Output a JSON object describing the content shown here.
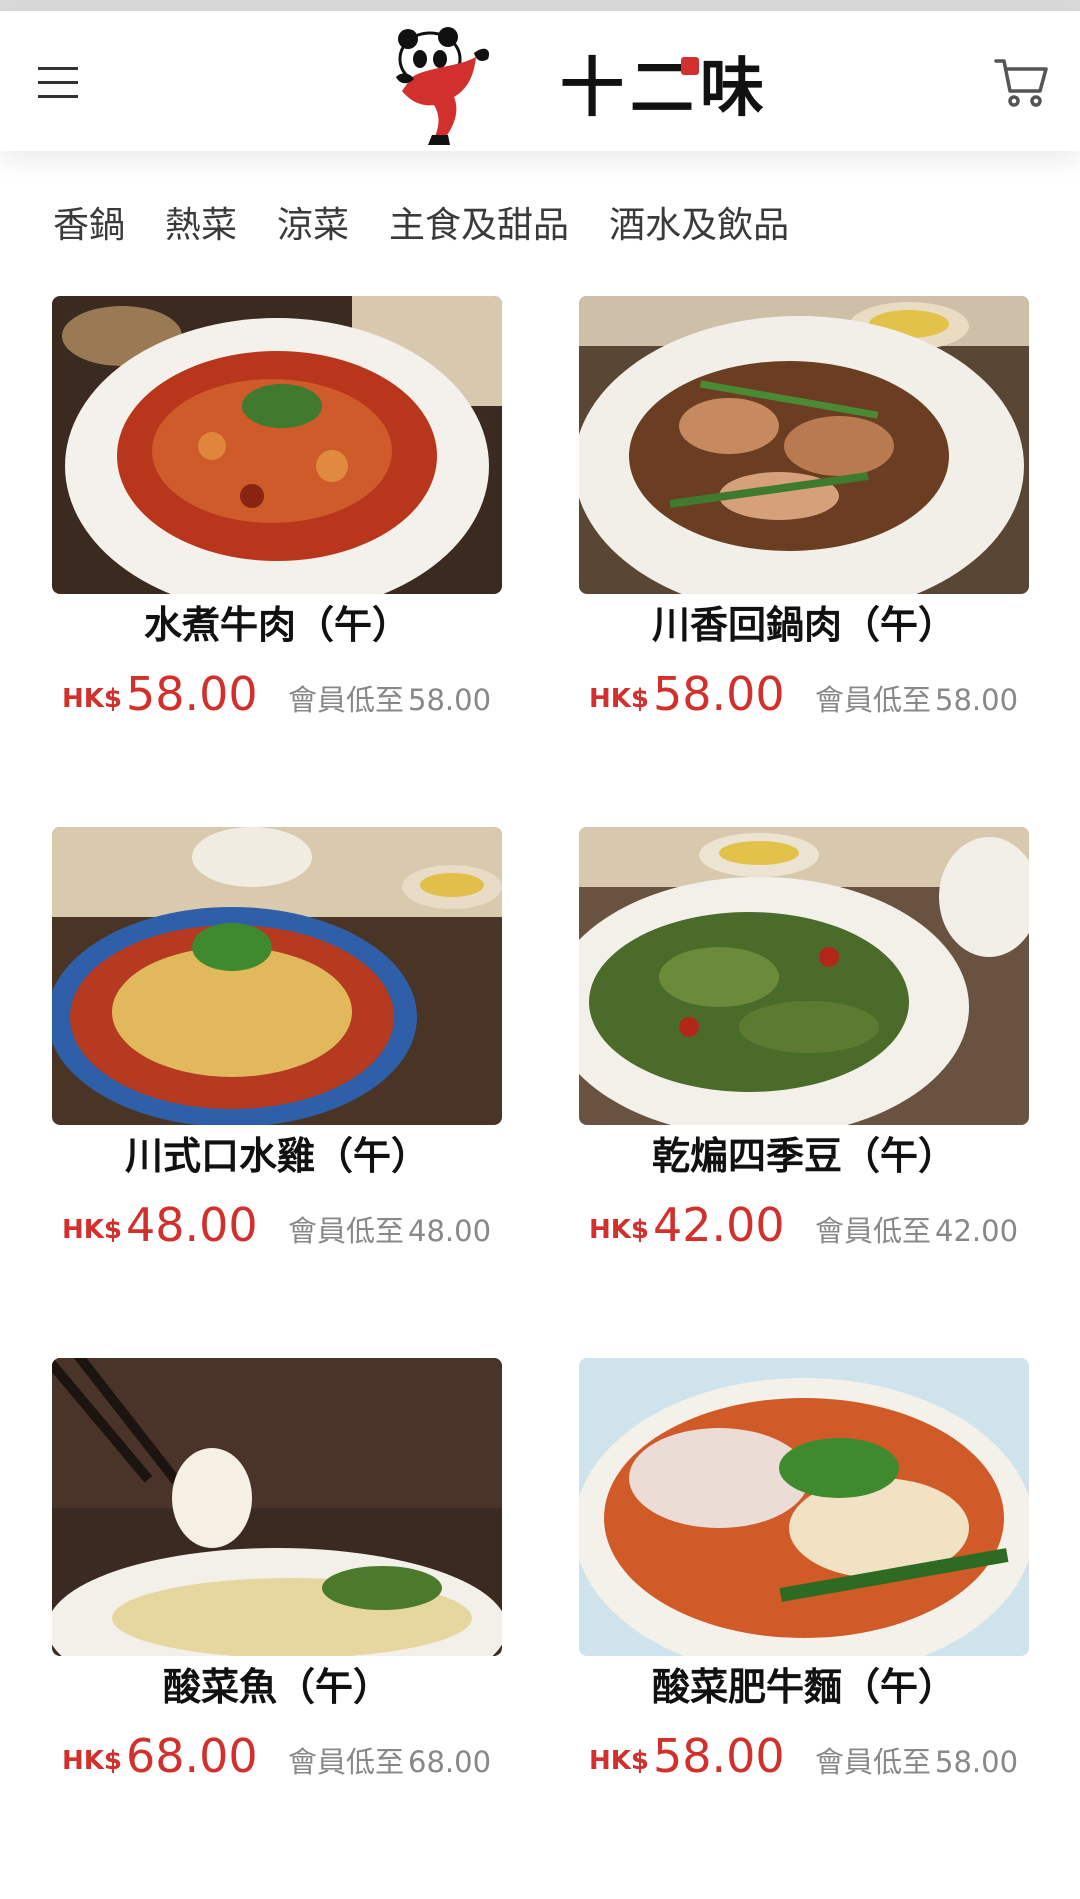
{
  "header": {
    "logo_text": "十二味",
    "menu_icon": "hamburger-menu-icon",
    "cart_icon": "shopping-cart-icon"
  },
  "categories": [
    "香鍋",
    "熱菜",
    "涼菜",
    "主食及甜品",
    "酒水及飲品"
  ],
  "colors": {
    "accent": "#d2302c",
    "muted": "#888888",
    "text": "#111111"
  },
  "products": [
    {
      "name": "水煮牛肉（午）",
      "currency": "HK$",
      "price": "58.00",
      "member_label": "會員低至",
      "member_price": "58.00"
    },
    {
      "name": "川香回鍋肉（午）",
      "currency": "HK$",
      "price": "58.00",
      "member_label": "會員低至",
      "member_price": "58.00"
    },
    {
      "name": "川式口水雞（午）",
      "currency": "HK$",
      "price": "48.00",
      "member_label": "會員低至",
      "member_price": "48.00"
    },
    {
      "name": "乾煸四季豆（午）",
      "currency": "HK$",
      "price": "42.00",
      "member_label": "會員低至",
      "member_price": "42.00"
    },
    {
      "name": "酸菜魚（午）",
      "currency": "HK$",
      "price": "68.00",
      "member_label": "會員低至",
      "member_price": "68.00"
    },
    {
      "name": "酸菜肥牛麵（午）",
      "currency": "HK$",
      "price": "58.00",
      "member_label": "會員低至",
      "member_price": "58.00"
    }
  ]
}
